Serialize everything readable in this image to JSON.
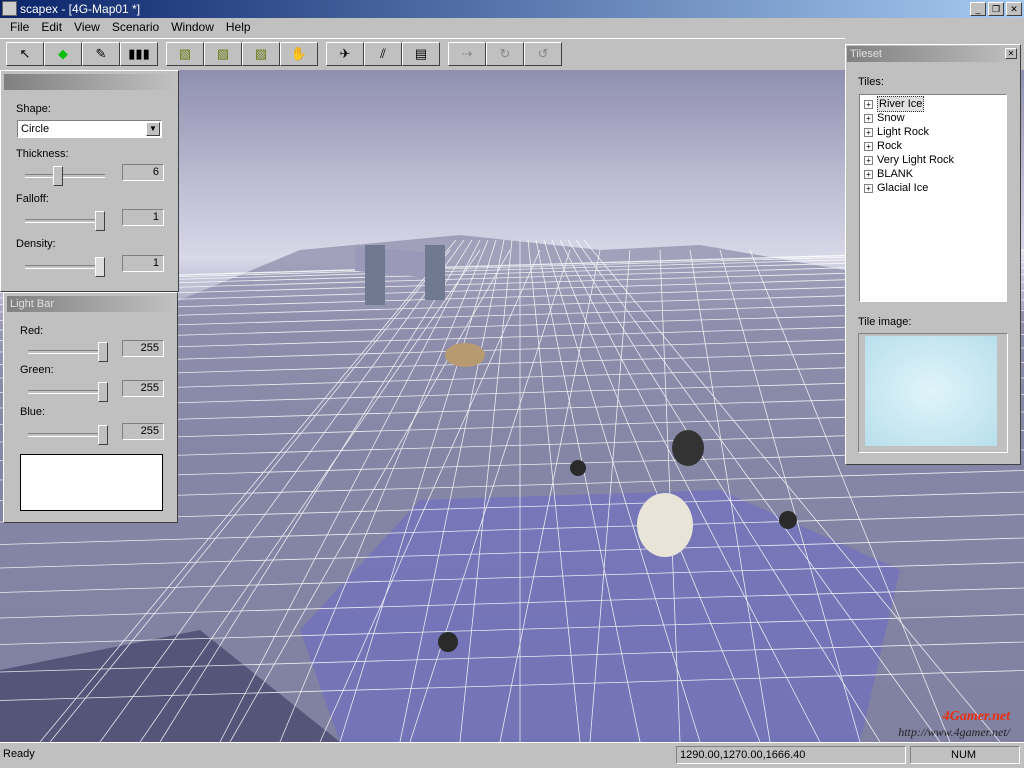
{
  "window": {
    "title": "scapex - [4G-Map01 *]"
  },
  "menu": [
    "File",
    "Edit",
    "View",
    "Scenario",
    "Window",
    "Help"
  ],
  "toolbar": [
    {
      "icon": "arrow-select-icon",
      "glyph": "↖"
    },
    {
      "icon": "green-point-icon",
      "glyph": "◆"
    },
    {
      "icon": "brush-icon",
      "glyph": "✎"
    },
    {
      "icon": "color-bars-icon",
      "glyph": "▮▮▮"
    },
    {
      "icon": "terrain-raise-icon",
      "glyph": "▧"
    },
    {
      "icon": "terrain-lower-icon",
      "glyph": "▧"
    },
    {
      "icon": "terrain-water-icon",
      "glyph": "▨"
    },
    {
      "icon": "hand-place-icon",
      "glyph": "✋"
    },
    {
      "icon": "object-icon",
      "glyph": "✈"
    },
    {
      "icon": "lines-icon",
      "glyph": "⫽"
    },
    {
      "icon": "properties-icon",
      "glyph": "▤"
    },
    {
      "icon": "path-icon",
      "glyph": "⇢"
    },
    {
      "icon": "rotate-cw-icon",
      "glyph": "↻"
    },
    {
      "icon": "rotate-ccw-icon",
      "glyph": "↺"
    }
  ],
  "brush": {
    "shape_label": "Shape:",
    "shape": "Circle",
    "thickness_label": "Thickness:",
    "thickness": "6",
    "falloff_label": "Falloff:",
    "falloff": "1",
    "density_label": "Density:",
    "density": "1",
    "thickness_fraction": 0.4,
    "falloff_fraction": 1,
    "density_fraction": 1
  },
  "lightbar": {
    "title": "Light Bar",
    "red_label": "Red:",
    "red": "255",
    "green_label": "Green:",
    "green": "255",
    "blue_label": "Blue:",
    "blue": "255"
  },
  "tileset": {
    "title": "Tileset",
    "tiles_label": "Tiles:",
    "tiles": [
      "River Ice",
      "Snow",
      "Light Rock",
      "Rock",
      "Very Light Rock",
      "BLANK",
      "Glacial Ice"
    ],
    "image_label": "Tile image:"
  },
  "status": {
    "text": "Ready",
    "coords": "1290.00,1270.00,1666.40",
    "num": "NUM"
  },
  "watermark": {
    "line1": "4Gamer.net",
    "line2": "http://www.4gamer.net/"
  }
}
